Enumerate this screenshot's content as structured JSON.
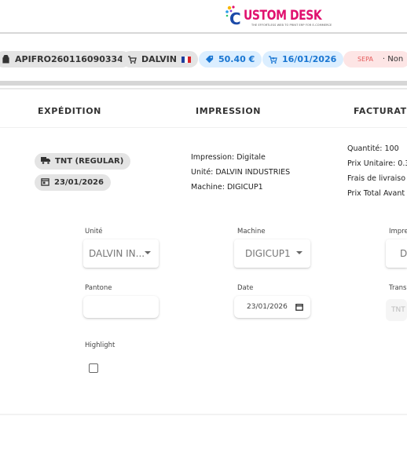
{
  "header": {
    "logo_text": "USTOM DESK",
    "logo_initial": "C",
    "logo_tagline": "THE EFFORTLESS WEB TO PRINT ERP FOR E-COMMERCE",
    "brand_color": "#e0116f"
  },
  "order_chips": {
    "order_ref": "APIFRO260116090334",
    "supplier": "DALVIN",
    "supplier_flag": "fr",
    "price": "50.40 €",
    "order_date": "16/01/2026",
    "payment_method": "SEPA",
    "payment_status": "· Non"
  },
  "columns": {
    "shipping": "EXPÉDITION",
    "printing": "IMPRESSION",
    "billing": "FACTURATIO"
  },
  "shipping": {
    "carrier": "TNT (REGULAR)",
    "ship_date": "23/01/2026"
  },
  "printing": {
    "type_line": "Impression: Digitale",
    "unit_line": "Unité: DALVIN INDUSTRIES",
    "machine_line": "Machine: DIGICUP1"
  },
  "billing": {
    "quantity_line": "Quantité: 100",
    "unit_price_line": "Prix Unitaire: 0.3",
    "delivery_line": "Frais de livraiso",
    "total_line": "Prix Total Avant"
  },
  "form": {
    "unit_label": "Unité",
    "unit_value": "DALVIN IN...",
    "machine_label": "Machine",
    "machine_value": "DIGICUP1",
    "print_label": "Impre",
    "print_value": "D",
    "pantone_label": "Pantone",
    "pantone_value": "",
    "date_label": "Date",
    "date_value": "23/01/2026",
    "transport_label": "Trans",
    "transport_value": "TNT",
    "highlight_label": "Highlight",
    "highlight_checked": false
  }
}
